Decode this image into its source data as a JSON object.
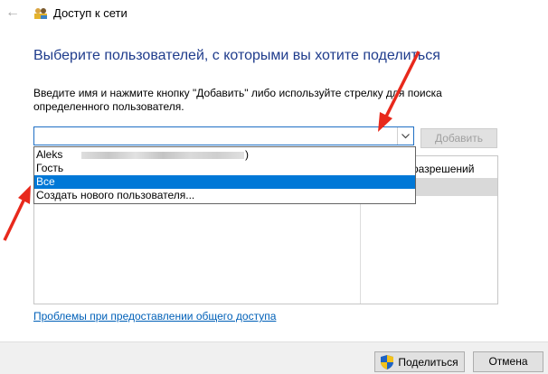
{
  "window": {
    "title": "Доступ к сети",
    "back_icon": "arrow-left-icon",
    "title_icon": "users-icon"
  },
  "main": {
    "heading": "Выберите пользователей, с которыми вы хотите поделиться",
    "description": "Введите имя и нажмите кнопку \"Добавить\" либо используйте стрелку для поиска определенного пользователя.",
    "input_value": "",
    "add_button": "Добавить",
    "table": {
      "permission_header": "разрешений"
    },
    "dropdown": {
      "items": [
        "Aleks",
        "Гость",
        "Все",
        "Создать нового пользователя..."
      ],
      "item0_suffix": ")",
      "selected_index": 2
    },
    "help_link": "Проблемы при предоставлении общего доступа"
  },
  "footer": {
    "share_button": "Поделиться",
    "cancel_button": "Отмена",
    "shield_icon": "uac-shield-icon"
  },
  "colors": {
    "accent": "#0078d7",
    "heading": "#1f3c8c",
    "link": "#0060b8",
    "arrow": "#e8291c"
  }
}
